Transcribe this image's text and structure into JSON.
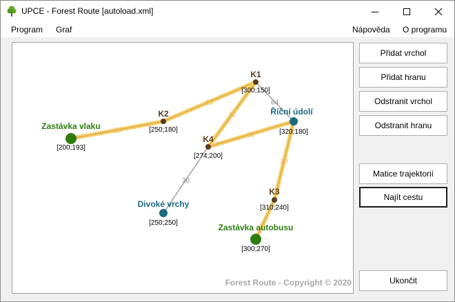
{
  "window": {
    "title": "UPCE - Forest Route [autoload.xml]"
  },
  "menu": {
    "program": "Program",
    "graf": "Graf",
    "napoveda": "Nápověda",
    "o_programu": "O programu"
  },
  "buttons": {
    "pridat_vrchol": "Přidat vrchol",
    "pridat_hranu": "Přidat hranu",
    "odstranit_vrchol": "Odstranit vrchol",
    "odstranit_hranu": "Odstranit hranu",
    "matice_trajektorii": "Matice trajektorií",
    "najit_cestu": "Najít cestu",
    "ukoncit": "Ukončit"
  },
  "canvas": {
    "copyright": "Forest  Route  -  Copyright © 2020"
  },
  "colors": {
    "stop_node": "#2e7d0f",
    "place_node": "#1a6a80",
    "crossroad_node": "#5a3a22",
    "highlight_edge": "#f6cf6f",
    "plain_edge": "#a0a0a0"
  },
  "graph": {
    "nodes": [
      {
        "id": "zv",
        "name": "Zastávka vlaku",
        "coord": "[200;193]",
        "kind": "stop"
      },
      {
        "id": "k2",
        "name": "K2",
        "coord": "[250;180]",
        "kind": "crossroad"
      },
      {
        "id": "k1",
        "name": "K1",
        "coord": "[300;150]",
        "kind": "crossroad"
      },
      {
        "id": "ru",
        "name": "Říční údolí",
        "coord": "[320;180]",
        "kind": "place"
      },
      {
        "id": "k4",
        "name": "K4",
        "coord": "[274;200]",
        "kind": "crossroad"
      },
      {
        "id": "dv",
        "name": "Divoké vrchy",
        "coord": "[250;250]",
        "kind": "place"
      },
      {
        "id": "k3",
        "name": "K3",
        "coord": "[310;240]",
        "kind": "crossroad"
      },
      {
        "id": "za",
        "name": "Zastávka autobusu",
        "coord": "[300;270]",
        "kind": "stop"
      }
    ],
    "edges": [
      {
        "from": "zv",
        "to": "k2",
        "weight": "35",
        "highlighted": true
      },
      {
        "from": "k2",
        "to": "k1",
        "weight": "15",
        "highlighted": true
      },
      {
        "from": "k1",
        "to": "k4",
        "weight": "30",
        "highlighted": true
      },
      {
        "from": "k1",
        "to": "ru",
        "weight": "64",
        "highlighted": false
      },
      {
        "from": "k4",
        "to": "ru",
        "weight": "32",
        "highlighted": true
      },
      {
        "from": "k4",
        "to": "dv",
        "weight": "30",
        "highlighted": false
      },
      {
        "from": "ru",
        "to": "k3",
        "weight": "20",
        "highlighted": true
      },
      {
        "from": "k3",
        "to": "za",
        "weight": "7",
        "highlighted": true
      }
    ]
  }
}
